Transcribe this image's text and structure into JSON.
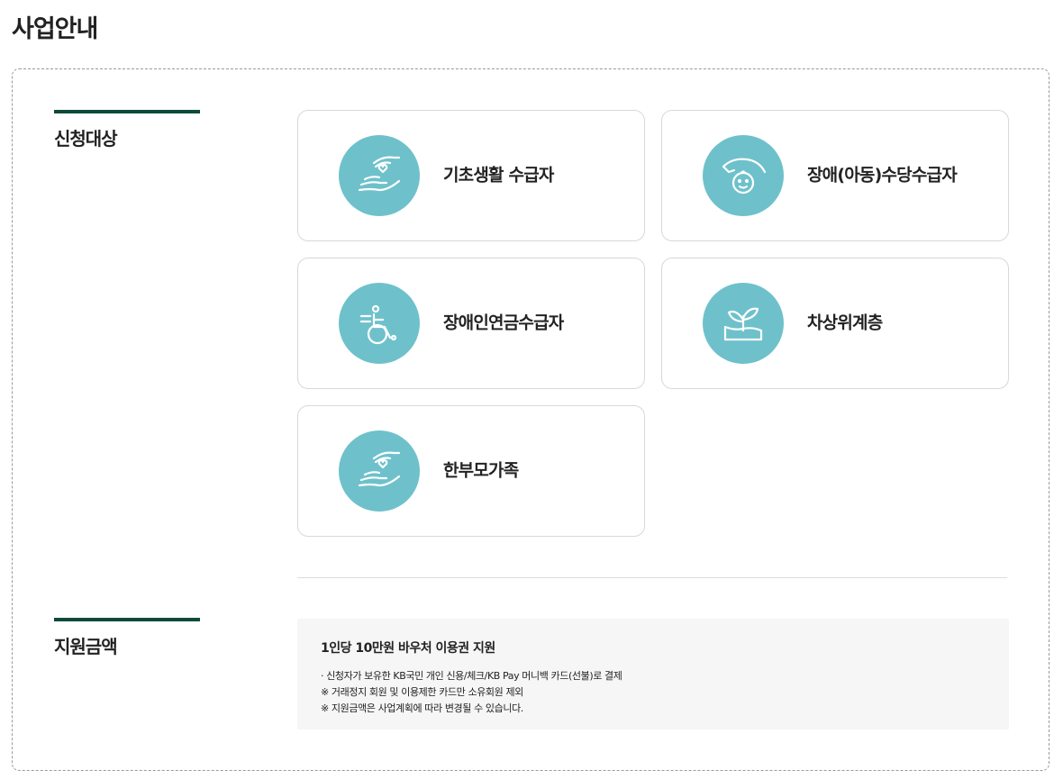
{
  "page": {
    "title": "사업안내"
  },
  "sections": {
    "applicants": {
      "label": "신청대상"
    },
    "support": {
      "label": "지원금액"
    }
  },
  "cards": [
    {
      "label": "기초생활 수급자",
      "icon": "hand-heart-icon"
    },
    {
      "label": "장애(아동)수당수급자",
      "icon": "child-care-icon"
    },
    {
      "label": "장애인연금수급자",
      "icon": "wheelchair-icon"
    },
    {
      "label": "차상위계층",
      "icon": "sprout-icon"
    },
    {
      "label": "한부모가족",
      "icon": "hand-heart-icon"
    }
  ],
  "support": {
    "title": "1인당 10만원 바우처 이용권 지원",
    "lines": [
      "· 신청자가 보유한 KB국민 개인 신용/체크/KB Pay 머니백 카드(선불)로 결제",
      "※ 거래정지 회원 및 이용제한 카드만 소유회원 제외",
      "※ 지원금액은 사업계획에 따라 변경될 수 있습니다."
    ]
  },
  "colors": {
    "accent": "#0e4a3c",
    "icon_circle": "#6ec1cb",
    "card_border": "#d8d8d8",
    "support_bg": "#f6f6f6"
  }
}
